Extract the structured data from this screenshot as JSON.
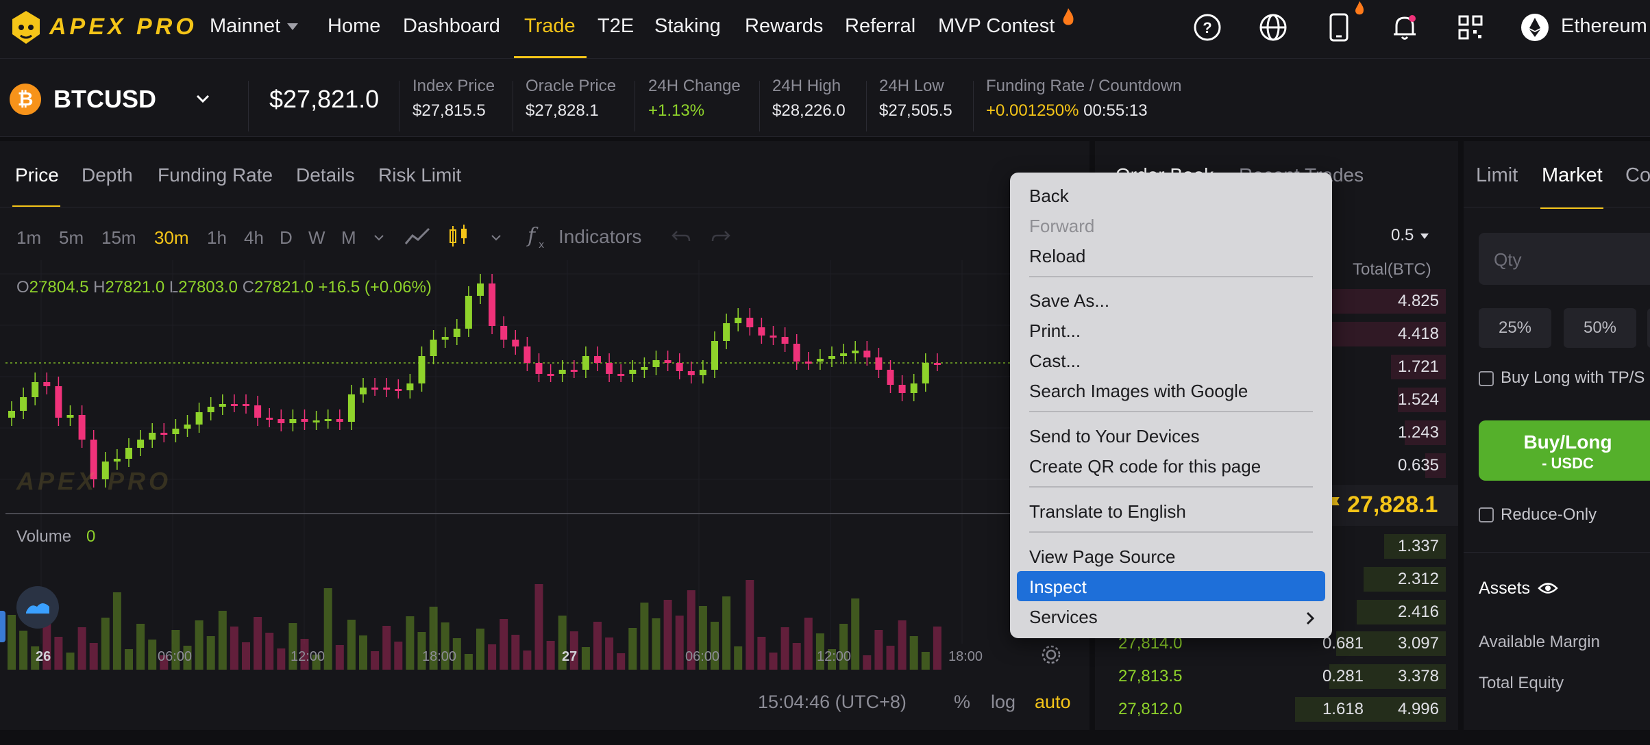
{
  "nav": {
    "brand": "APEX PRO",
    "network": "Mainnet",
    "items": [
      "Home",
      "Dashboard",
      "Trade",
      "T2E",
      "Staking",
      "Rewards",
      "Referral",
      "MVP Contest"
    ],
    "active": "Trade",
    "chain": "Ethereum"
  },
  "ticker": {
    "symbol": "BTCUSD",
    "price": "$27,821.0",
    "stats": [
      {
        "label": "Index Price",
        "value": "$27,815.5"
      },
      {
        "label": "Oracle Price",
        "value": "$27,828.1"
      },
      {
        "label": "24H Change",
        "value": "+1.13%"
      },
      {
        "label": "24H High",
        "value": "$28,226.0"
      },
      {
        "label": "24H Low",
        "value": "$27,505.5"
      },
      {
        "label": "Funding Rate / Countdown",
        "value": "+0.001250%",
        "countdown": "00:55:13"
      }
    ]
  },
  "chart": {
    "tabs": [
      "Price",
      "Depth",
      "Funding Rate",
      "Details",
      "Risk Limit"
    ],
    "active_tab": "Price",
    "timeframes": [
      "1m",
      "5m",
      "15m",
      "30m",
      "1h",
      "4h",
      "D",
      "W",
      "M"
    ],
    "active_tf": "30m",
    "indicators_label": "Indicators",
    "ohlc": {
      "o": "27804.5",
      "h": "27821.0",
      "l": "27803.0",
      "c": "27821.0",
      "chg": "+16.5 (+0.06%)"
    },
    "volume_label": "Volume",
    "volume_value": "0",
    "x_labels": [
      "26",
      "06:00",
      "12:00",
      "18:00",
      "27",
      "06:00",
      "12:00",
      "18:00"
    ],
    "timestamp": "15:04:46 (UTC+8)",
    "scale": {
      "pct": "%",
      "log": "log",
      "auto": "auto"
    },
    "watermark": "APEX PRO"
  },
  "orderbook": {
    "tabs": [
      "Order Book",
      "Recent Trades"
    ],
    "precision": "0.5",
    "total_header": "Total(BTC)",
    "asks_totals": [
      "4.825",
      "4.418",
      "1.721",
      "1.524",
      "1.243",
      "0.635"
    ],
    "mid_price": "27,828.1",
    "bids": [
      {
        "price": "",
        "size": "",
        "total": "1.337"
      },
      {
        "price": "",
        "size": "",
        "total": "2.312"
      },
      {
        "price": "",
        "size": "",
        "total": "2.416"
      },
      {
        "price": "27,814.0",
        "size": "0.681",
        "total": "3.097"
      },
      {
        "price": "27,813.5",
        "size": "0.281",
        "total": "3.378"
      },
      {
        "price": "27,812.0",
        "size": "1.618",
        "total": "4.996"
      }
    ]
  },
  "trade": {
    "tabs": [
      "Limit",
      "Market",
      "Co"
    ],
    "active_tab": "Market",
    "qty_placeholder": "Qty",
    "pcts": [
      "25%",
      "50%"
    ],
    "buy_long_tpsl": "Buy Long with TP/S",
    "buy_button_l1": "Buy/Long",
    "buy_button_l2": "- USDC",
    "reduce_only": "Reduce-Only",
    "assets": "Assets",
    "available_margin": "Available Margin",
    "total_equity": "Total Equity"
  },
  "context_menu": {
    "items": [
      {
        "label": "Back"
      },
      {
        "label": "Forward",
        "disabled": true
      },
      {
        "label": "Reload"
      },
      {
        "label": "Save As..."
      },
      {
        "label": "Print..."
      },
      {
        "label": "Cast..."
      },
      {
        "label": "Search Images with Google"
      },
      {
        "label": "Send to Your Devices"
      },
      {
        "label": "Create QR code for this page"
      },
      {
        "label": "Translate to English"
      },
      {
        "label": "View Page Source"
      },
      {
        "label": "Inspect",
        "highlighted": true
      },
      {
        "label": "Services",
        "submenu": true
      }
    ]
  },
  "colors": {
    "accent": "#f5c518",
    "up": "#8fd32b",
    "down": "#f0327a",
    "menu_highlight": "#1e6fd9"
  }
}
